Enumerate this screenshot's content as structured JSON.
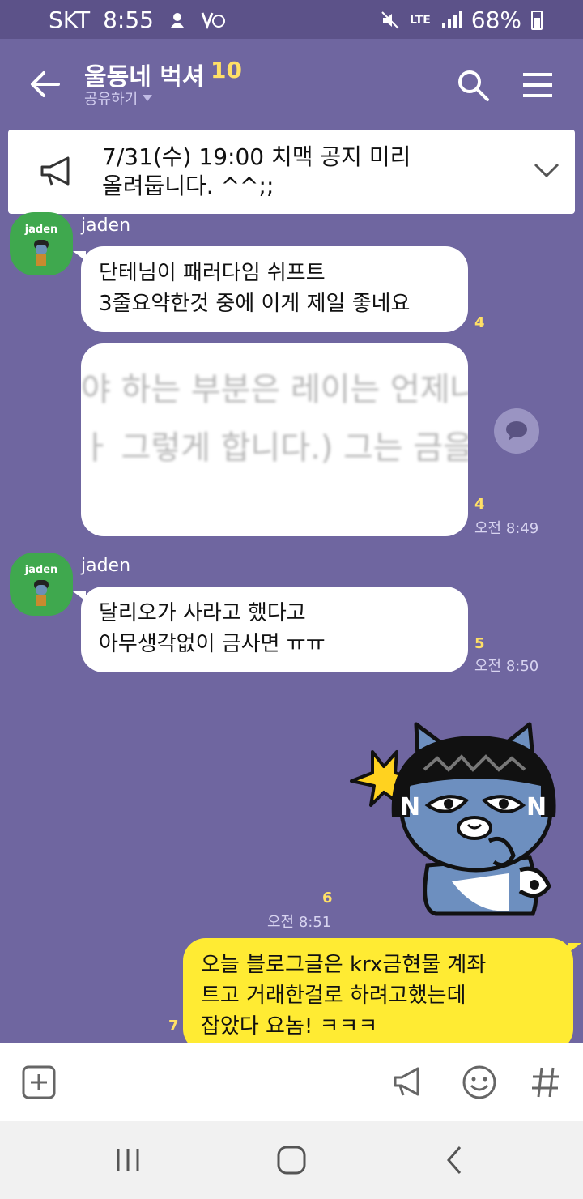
{
  "status_bar": {
    "carrier": "SKT",
    "time": "8:55",
    "network": "LTE",
    "battery": "68%"
  },
  "header": {
    "title": "울동네 벅셔",
    "member_count": "10",
    "share_label": "공유하기"
  },
  "notice": {
    "text": "7/31(수) 19:00 치맥 공지 미리\n올려둡니다. ^^;;"
  },
  "messages": [
    {
      "sender": "jaden",
      "avatar_label": "jaden",
      "text": "단테님이 패러다임 쉬프트\n3줄요약한것 중에 이게 제일 좋네요",
      "unread": "4"
    },
    {
      "image_text_lines": [
        "야 하는 부분은 레이는 언제나",
        "ㅏ 그렇게 합니다.) 그는 금을"
      ],
      "unread": "4",
      "time": "오전 8:49"
    },
    {
      "sender": "jaden",
      "avatar_label": "jaden",
      "text": "달리오가 사라고 했다고\n아무생각없이 금사면 ㅠㅠ",
      "unread": "5",
      "time": "오전 8:50"
    },
    {
      "sticker": "cat-sticker",
      "unread": "6",
      "time": "오전 8:51"
    },
    {
      "mine": true,
      "text": "오늘 블로그글은 krx금현물 계좌\n트고 거래한걸로 하려고했는데\n잡았다 요놈! ㅋㅋㅋ",
      "unread": "7"
    }
  ],
  "input_bar": {
    "icons": [
      "plus-icon",
      "megaphone-icon",
      "emoji-icon",
      "hash-icon"
    ]
  },
  "nav_bar": {
    "icons": [
      "recents-icon",
      "home-icon",
      "back-icon"
    ]
  },
  "colors": {
    "background": "#6f66a0",
    "status_bar": "#5c5289",
    "my_bubble": "#ffeb33",
    "unread": "#ffe066",
    "avatar": "#3fa84e"
  }
}
